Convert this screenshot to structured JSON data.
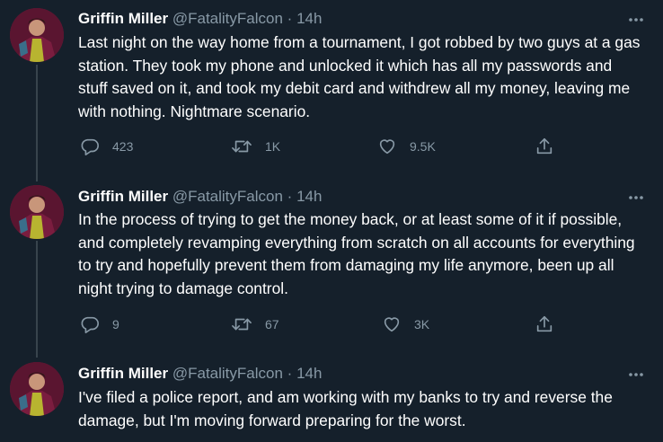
{
  "tweets": [
    {
      "name": "Griffin Miller",
      "handle": "@FatalityFalcon",
      "separator": "·",
      "time": "14h",
      "text": "Last night on the way home from a tournament, I got robbed by two guys at a gas station. They took my phone and unlocked it which has all my passwords and stuff saved on it, and took my debit card and withdrew all my money, leaving me with nothing. Nightmare scenario.",
      "replies": "423",
      "retweets": "1K",
      "likes": "9.5K"
    },
    {
      "name": "Griffin Miller",
      "handle": "@FatalityFalcon",
      "separator": "·",
      "time": "14h",
      "text": "In the process of trying to get the money back, or at least some of it if possible, and completely revamping everything from scratch on all accounts for everything to try and hopefully prevent them from damaging my life anymore, been up all night trying to damage control.",
      "replies": "9",
      "retweets": "67",
      "likes": "3K"
    },
    {
      "name": "Griffin Miller",
      "handle": "@FatalityFalcon",
      "separator": "·",
      "time": "14h",
      "text": "I've filed a police report, and am working with my banks to try and reverse the damage, but I'm moving forward preparing for the worst."
    }
  ],
  "colors": {
    "background": "#15202b",
    "secondary_text": "#8899a6",
    "thread_line": "#38444d"
  },
  "icons": {
    "reply": "reply-icon",
    "retweet": "retweet-icon",
    "like": "heart-icon",
    "share": "share-icon",
    "more": "more-options-icon"
  }
}
